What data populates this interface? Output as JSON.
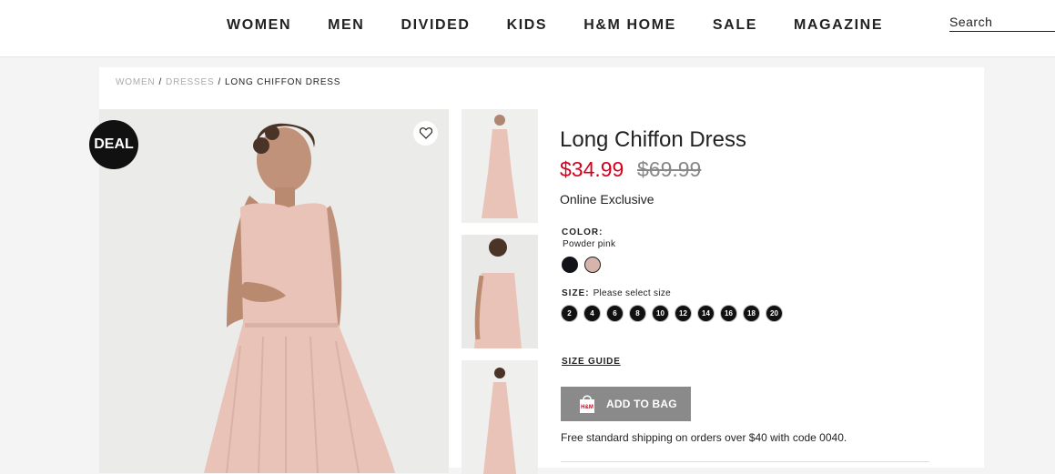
{
  "nav": {
    "items": [
      "WOMEN",
      "MEN",
      "DIVIDED",
      "KIDS",
      "H&M HOME",
      "SALE",
      "MAGAZINE"
    ]
  },
  "search": {
    "placeholder": "Search"
  },
  "breadcrumb": {
    "items": [
      "WOMEN",
      "DRESSES",
      "LONG CHIFFON DRESS"
    ],
    "separator": "/"
  },
  "badges": {
    "deal": "DEAL"
  },
  "product": {
    "title": "Long Chiffon Dress",
    "price_sale": "$34.99",
    "price_original": "$69.99",
    "exclusive": "Online Exclusive",
    "color_label": "COLOR:",
    "color_value": "Powder pink",
    "colors": [
      "#111318",
      "#d7b3ab"
    ],
    "size_label": "SIZE:",
    "size_hint": "Please select size",
    "sizes": [
      "2",
      "4",
      "6",
      "8",
      "10",
      "12",
      "14",
      "16",
      "18",
      "20"
    ],
    "size_guide": "SIZE GUIDE",
    "add_to_bag": "ADD TO BAG",
    "bag_icon_text": "H&M",
    "shipping": "Free standard shipping on orders over $40 with code 0040."
  },
  "icons": [
    "heart-icon",
    "shopping-bag-icon"
  ],
  "colors": {
    "price_sale": "#d6001c",
    "dress": "#e9c1b7",
    "button": "#8a8a8a"
  }
}
